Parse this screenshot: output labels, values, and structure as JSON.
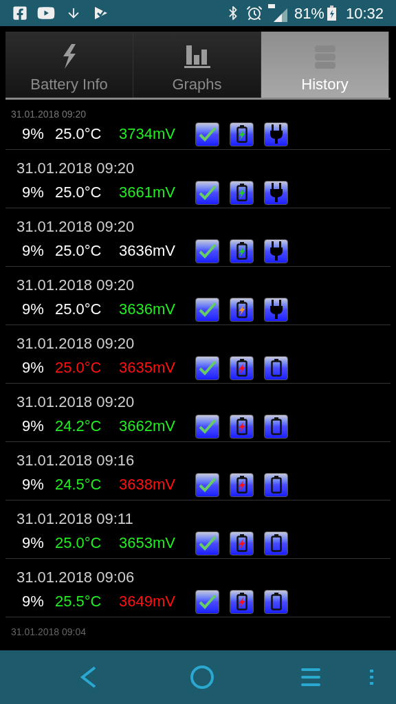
{
  "status_bar": {
    "battery": "81%",
    "time": "10:32"
  },
  "tabs": [
    {
      "label": "Battery Info",
      "selected": false,
      "kind": "bolt"
    },
    {
      "label": "Graphs",
      "selected": false,
      "kind": "bars"
    },
    {
      "label": "History",
      "selected": true,
      "kind": "stack"
    }
  ],
  "history": {
    "top_partial_date": "31.01.2018 09:20",
    "entries": [
      {
        "percent": "9%",
        "temperature": {
          "text": "25.0°C",
          "color": "#ffffff"
        },
        "voltage": {
          "text": "3734mV",
          "color": "#22ee22"
        },
        "battery": {
          "color": "#22cc22"
        },
        "power": {
          "kind": "plug"
        }
      },
      {
        "date": "31.01.2018 09:20",
        "percent": "9%",
        "temperature": {
          "text": "25.0°C",
          "color": "#ffffff"
        },
        "voltage": {
          "text": "3661mV",
          "color": "#22ee22"
        },
        "battery": {
          "color": "#22cc22"
        },
        "power": {
          "kind": "plug"
        }
      },
      {
        "date": "31.01.2018 09:20",
        "percent": "9%",
        "temperature": {
          "text": "25.0°C",
          "color": "#ffffff"
        },
        "voltage": {
          "text": "3636mV",
          "color": "#ffffff"
        },
        "battery": {
          "color": "#22cc22"
        },
        "power": {
          "kind": "plug"
        }
      },
      {
        "date": "31.01.2018 09:20",
        "percent": "9%",
        "temperature": {
          "text": "25.0°C",
          "color": "#ffffff"
        },
        "voltage": {
          "text": "3636mV",
          "color": "#22ee22"
        },
        "battery": {
          "color": "#ee9922"
        },
        "power": {
          "kind": "plug"
        }
      },
      {
        "date": "31.01.2018 09:20",
        "percent": "9%",
        "temperature": {
          "text": "25.0°C",
          "color": "#ff1111"
        },
        "voltage": {
          "text": "3635mV",
          "color": "#ff1111"
        },
        "battery": {
          "color": "#ff1111"
        },
        "power": {
          "kind": "empty"
        }
      },
      {
        "date": "31.01.2018 09:20",
        "percent": "9%",
        "temperature": {
          "text": "24.2°C",
          "color": "#22ee22"
        },
        "voltage": {
          "text": "3662mV",
          "color": "#22ee22"
        },
        "battery": {
          "color": "#ff1111"
        },
        "power": {
          "kind": "empty"
        }
      },
      {
        "date": "31.01.2018 09:16",
        "percent": "9%",
        "temperature": {
          "text": "24.5°C",
          "color": "#22ee22"
        },
        "voltage": {
          "text": "3638mV",
          "color": "#ff1111"
        },
        "battery": {
          "color": "#ff1111"
        },
        "power": {
          "kind": "empty"
        }
      },
      {
        "date": "31.01.2018 09:11",
        "percent": "9%",
        "temperature": {
          "text": "25.0°C",
          "color": "#22ee22"
        },
        "voltage": {
          "text": "3653mV",
          "color": "#22ee22"
        },
        "battery": {
          "color": "#ff1111"
        },
        "power": {
          "kind": "empty"
        }
      },
      {
        "date": "31.01.2018 09:06",
        "percent": "9%",
        "temperature": {
          "text": "25.5°C",
          "color": "#22ee22"
        },
        "voltage": {
          "text": "3649mV",
          "color": "#ff1111"
        },
        "battery": {
          "color": "#ff1111"
        },
        "power": {
          "kind": "empty"
        }
      }
    ],
    "bottom_partial_date": "31.01.2018 09:04"
  }
}
